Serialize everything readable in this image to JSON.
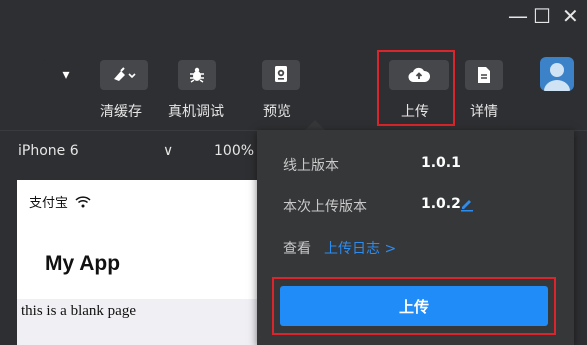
{
  "window": {
    "minimize": "—",
    "maximize": "☐",
    "close": "✕"
  },
  "toolbar": {
    "dropdown_arrow": "▾",
    "items": [
      {
        "label": "清缓存",
        "icon": "broom-icon"
      },
      {
        "label": "真机调试",
        "icon": "bug-icon"
      },
      {
        "label": "预览",
        "icon": "preview-icon"
      },
      {
        "label": "上传",
        "icon": "cloud-upload-icon"
      },
      {
        "label": "详情",
        "icon": "document-icon"
      }
    ]
  },
  "subbar": {
    "device": "iPhone 6",
    "device_arrow": "∨",
    "zoom": "100%"
  },
  "simulator": {
    "status_app": "支付宝",
    "page_title": "My App",
    "body_text": "this is a blank page"
  },
  "upload_popup": {
    "online_version_label": "线上版本",
    "online_version_value": "1.0.1",
    "current_version_label": "本次上传版本",
    "current_version_value": "1.0.2",
    "view_label": "查看",
    "log_link": "上传日志 >",
    "upload_button": "上传"
  },
  "colors": {
    "background": "#2e2f32",
    "popup": "#363739",
    "accent_blue": "#1f8cf7",
    "highlight_red": "#d9252b"
  }
}
